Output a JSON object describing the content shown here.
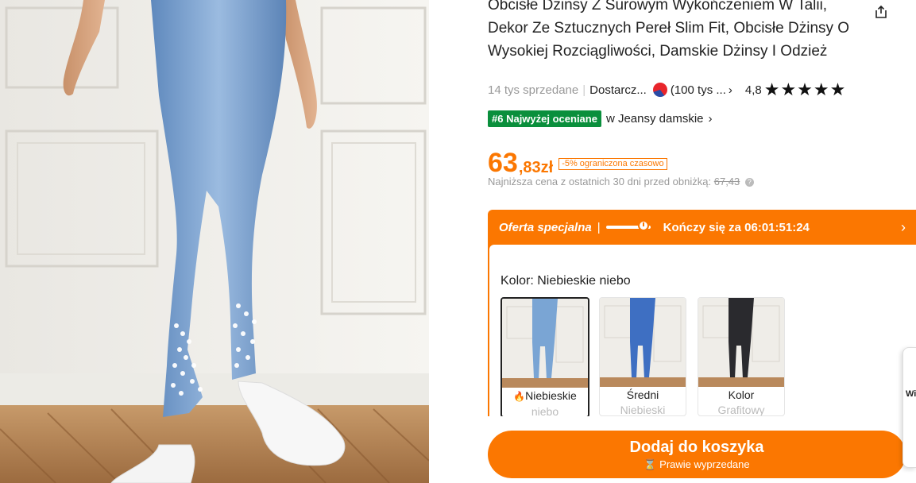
{
  "product": {
    "title": "Obcisłe Dżinsy Z Surowym Wykończeniem W Talii, Dekor Ze Sztucznych Pereł Slim Fit, Obcisłe Dżinsy O Wysokiej Rozciągliwości, Damskie Dżinsy I Odzież",
    "share_icon": "share-icon",
    "sold": "14 tys sprzedane",
    "seller": "Dostarcz...",
    "seller_reviews": "(100 tys ...",
    "rating": "4,8",
    "stars": "★★★★★",
    "rank_badge": "#6 Najwyżej oceniane",
    "rank_category": "w Jeansy damskie",
    "price_main": "63",
    "price_decimal": ",83zł",
    "discount_tag": "-5% ograniczona czasowo",
    "lowest_price_label": "Najniższa cena z ostatnich 30 dni przed obniżką:",
    "lowest_price_value": "67,43"
  },
  "offer": {
    "title": "Oferta specjalna",
    "countdown": "Kończy się za 06:01:51:24",
    "progress": 0.85,
    "color_label": "Kolor: Niebieskie niebo",
    "swatches": [
      {
        "line1": "Niebieskie",
        "line2": "niebo",
        "selected": true,
        "denim": "#7aa5d4"
      },
      {
        "line1": "Średni",
        "line2": "Niebieski",
        "selected": false,
        "denim": "#3e6fc2"
      },
      {
        "line1": "Kolor",
        "line2": "Grafitowy",
        "selected": false,
        "denim": "#2a2a2e"
      }
    ]
  },
  "cta": {
    "label": "Dodaj do koszyka",
    "sub": "Prawie wyprzedane"
  },
  "side_panel_text": "Wi",
  "colors": {
    "accent": "#fb7701",
    "rank_green": "#0a8f3c"
  }
}
